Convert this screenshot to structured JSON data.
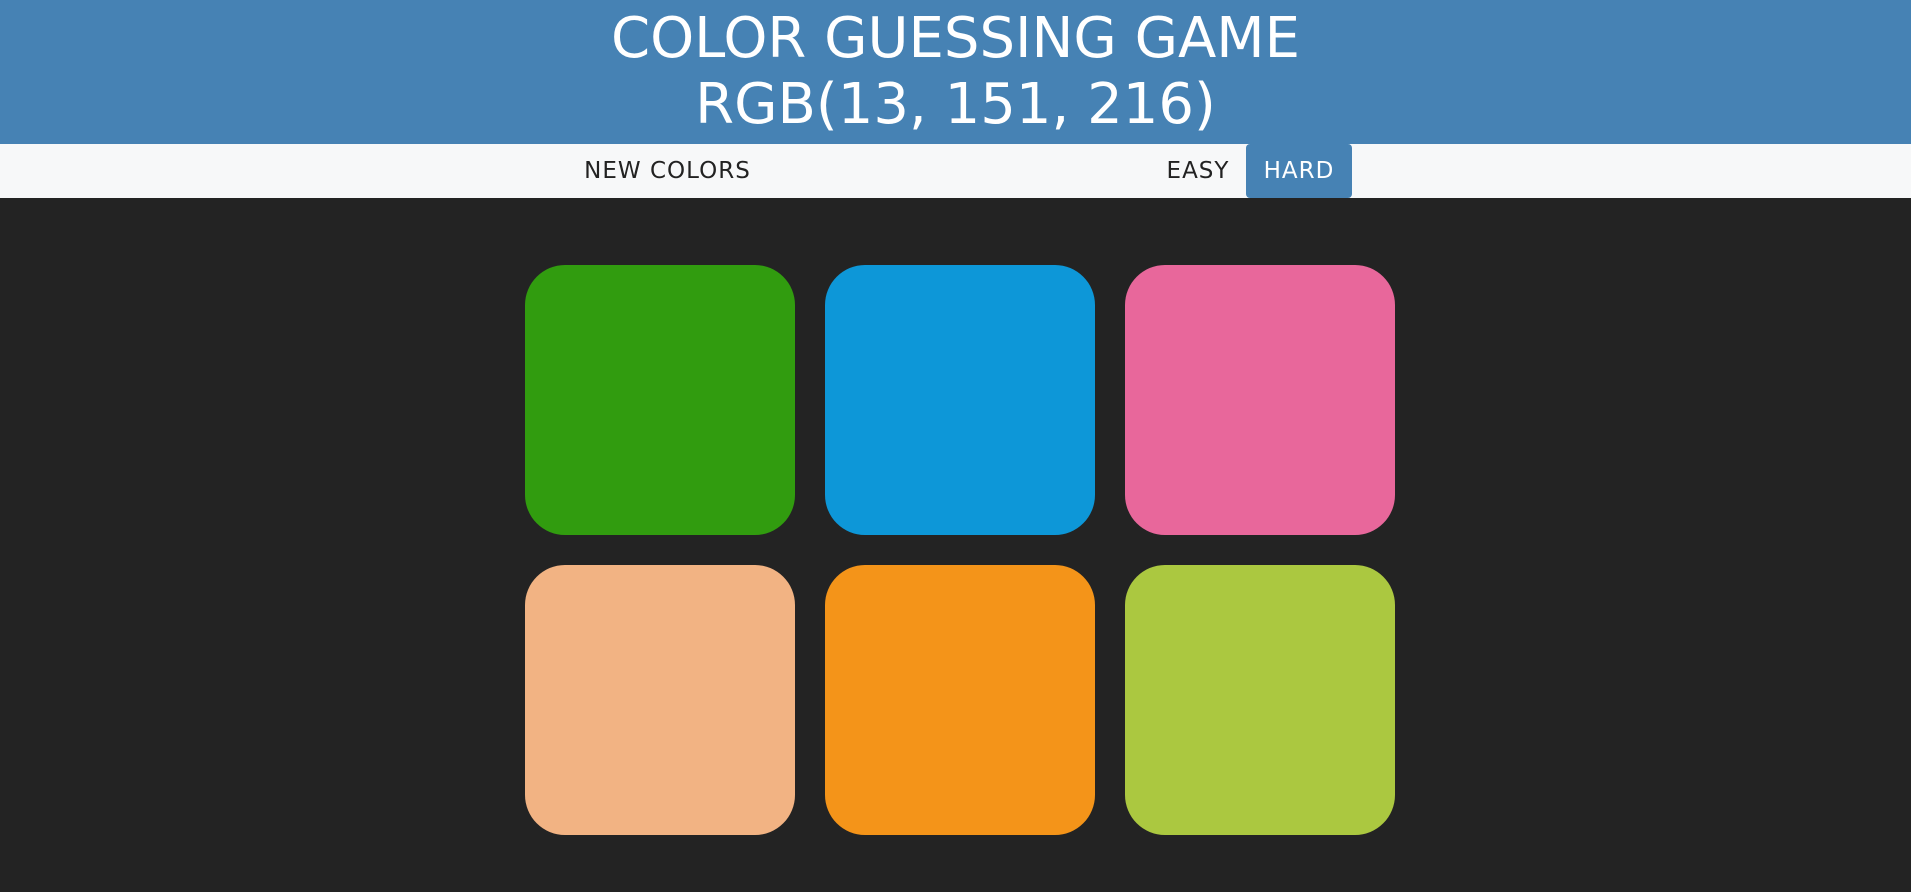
{
  "header": {
    "title": "COLOR GUESSING GAME",
    "target_color": "RGB(13, 151, 216)",
    "background": "#4682b4"
  },
  "toolbar": {
    "new_colors_label": "NEW COLORS",
    "easy_label": "EASY",
    "hard_label": "HARD",
    "active_mode": "HARD"
  },
  "board": {
    "background": "#232323",
    "squares": [
      {
        "color": "#319c0f"
      },
      {
        "color": "#0d97d8"
      },
      {
        "color": "#e8679b"
      },
      {
        "color": "#f2b383"
      },
      {
        "color": "#f49419"
      },
      {
        "color": "#abc840"
      }
    ]
  }
}
